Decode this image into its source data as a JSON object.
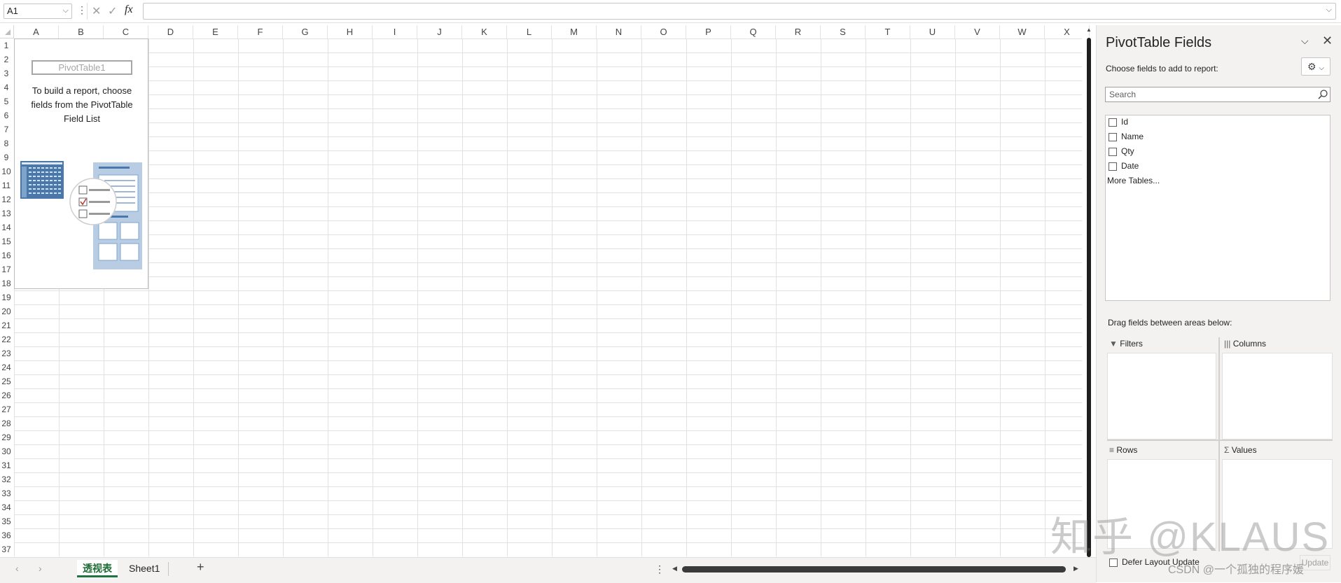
{
  "formula_bar": {
    "name_box": "A1",
    "fx": "fx",
    "cancel": "✕",
    "enter": "✓",
    "formula": ""
  },
  "columns": [
    "A",
    "B",
    "C",
    "D",
    "E",
    "F",
    "G",
    "H",
    "I",
    "J",
    "K",
    "L",
    "M",
    "N",
    "O",
    "P",
    "Q",
    "R",
    "S",
    "T",
    "U",
    "V",
    "W",
    "X"
  ],
  "rows": [
    "1",
    "2",
    "3",
    "4",
    "5",
    "6",
    "7",
    "8",
    "9",
    "10",
    "11",
    "12",
    "13",
    "14",
    "15",
    "16",
    "17",
    "18",
    "19",
    "20",
    "21",
    "22",
    "23",
    "24",
    "25",
    "26",
    "27",
    "28",
    "29",
    "30",
    "31",
    "32",
    "33",
    "34",
    "35",
    "36",
    "37"
  ],
  "pivot_placeholder": {
    "name": "PivotTable1",
    "hint_lines": [
      "To build a report, choose",
      "fields from the PivotTable",
      "Field List"
    ]
  },
  "sheet_tabs": {
    "active": "透视表",
    "other": "Sheet1",
    "add": "+",
    "more": "⋮"
  },
  "pane": {
    "title": "PivotTable Fields",
    "subtitle": "Choose fields to add to report:",
    "search_placeholder": "Search",
    "fields": [
      "Id",
      "Name",
      "Qty",
      "Date"
    ],
    "more_tables": "More Tables...",
    "drag_hint": "Drag fields between areas below:",
    "areas": {
      "filters": "Filters",
      "columns": "Columns",
      "rows": "Rows",
      "values": "Values"
    },
    "defer_label": "Defer Layout Update",
    "update_label": "Update"
  },
  "watermark": "知乎 @KLAUS",
  "credit": "CSDN @一个孤独的程序媛"
}
